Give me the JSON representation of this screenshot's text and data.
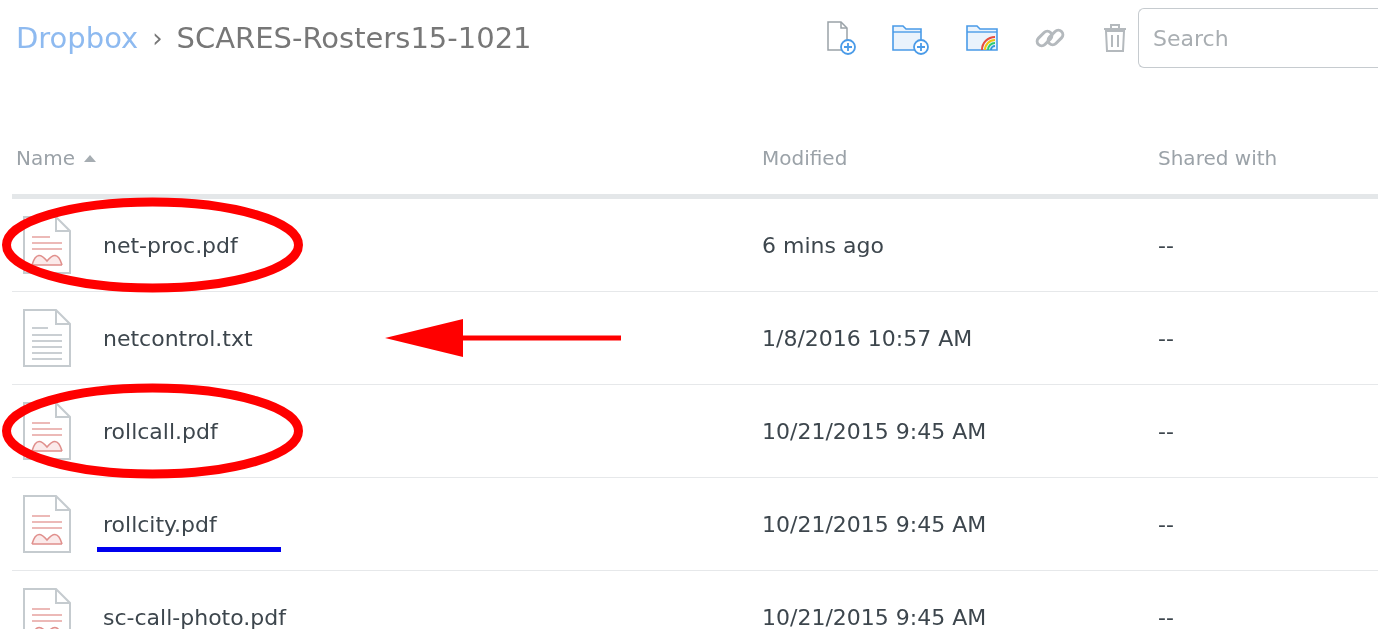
{
  "breadcrumb": {
    "root": "Dropbox",
    "separator": "›",
    "folder": "SCARES-Rosters15-1021"
  },
  "toolbar": {
    "search": {
      "placeholder": "Search"
    }
  },
  "table": {
    "columns": [
      {
        "label": "Name",
        "sorted": true
      },
      {
        "label": "Modified",
        "sorted": false
      },
      {
        "label": "Shared with",
        "sorted": false
      }
    ],
    "rows": [
      {
        "kind": "pdf",
        "name": "net-proc.pdf",
        "modified": "6 mins ago",
        "shared": "--",
        "circled": true,
        "arrowed": false,
        "underlined": false
      },
      {
        "kind": "txt",
        "name": "netcontrol.txt",
        "modified": "1/8/2016 10:57 AM",
        "shared": "--",
        "circled": false,
        "arrowed": true,
        "underlined": false
      },
      {
        "kind": "pdf",
        "name": "rollcall.pdf",
        "modified": "10/21/2015 9:45 AM",
        "shared": "--",
        "circled": true,
        "arrowed": false,
        "underlined": false
      },
      {
        "kind": "pdf",
        "name": "rollcity.pdf",
        "modified": "10/21/2015 9:45 AM",
        "shared": "--",
        "circled": false,
        "arrowed": false,
        "underlined": true
      },
      {
        "kind": "pdf",
        "name": "sc-call-photo.pdf",
        "modified": "10/21/2015 9:45 AM",
        "shared": "--",
        "circled": false,
        "arrowed": false,
        "underlined": false
      }
    ]
  }
}
